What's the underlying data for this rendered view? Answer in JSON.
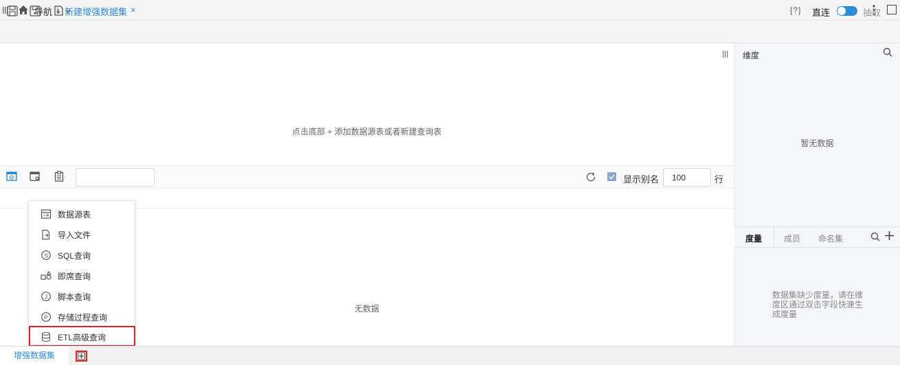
{
  "topbar": {
    "nav_label": "导航",
    "active_tab": "新建增强数据集",
    "close_glyph": "×"
  },
  "toolbar": {
    "icons": [
      "save-icon",
      "save-as-icon",
      "export-icon"
    ],
    "help": "[?]",
    "direct_label": "直连",
    "extract_label": "抽取",
    "toggle_color": "#2e8bd8"
  },
  "canvas": {
    "hint": "点击底部 + 添加数据源表或者新建查询表"
  },
  "preview": {
    "search_value": "",
    "show_alias_label": "显示别名",
    "show_alias_checked": true,
    "rows_value": "100",
    "rows_unit": "行",
    "empty_text": "无数据"
  },
  "add_menu": {
    "items": [
      {
        "label": "数据源表",
        "icon": "table-icon"
      },
      {
        "label": "导入文件",
        "icon": "file-import-icon"
      },
      {
        "label": "SQL查询",
        "icon": "sql-query-icon"
      },
      {
        "label": "即席查询",
        "icon": "adhoc-query-icon"
      },
      {
        "label": "脚本查询",
        "icon": "script-query-icon"
      },
      {
        "label": "存储过程查询",
        "icon": "procedure-query-icon"
      },
      {
        "label": "ETL高级查询",
        "icon": "etl-query-icon",
        "highlighted": true
      }
    ]
  },
  "bottom": {
    "tab_label": "增强数据集",
    "add_glyph": "+"
  },
  "right_panel": {
    "dimension_title": "维度",
    "dimension_empty": "暂无数据",
    "tabs": [
      "度量",
      "成员",
      "命名集"
    ],
    "measure_empty": "数据集缺少度量，请在维度区通过双击字段快速生成度量"
  },
  "colors": {
    "accent": "#2e8bd8",
    "highlight_border": "#e02020"
  }
}
